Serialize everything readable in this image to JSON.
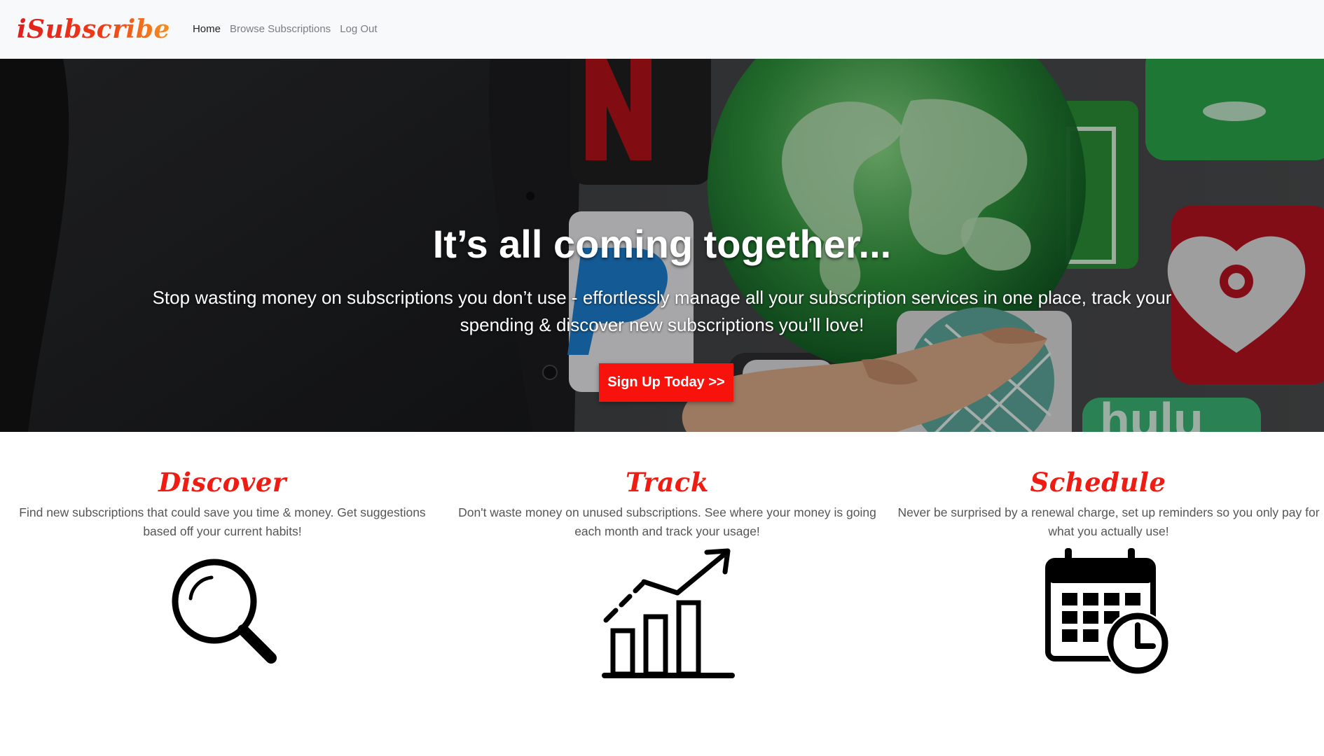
{
  "navbar": {
    "brand": "iSubscribe",
    "links": [
      {
        "label": "Home",
        "active": true
      },
      {
        "label": "Browse Subscriptions",
        "active": false
      },
      {
        "label": "Log Out",
        "active": false
      }
    ]
  },
  "hero": {
    "title": "It’s all coming together...",
    "subtitle": "Stop wasting money on subscriptions you don’t use - effortlessly manage all your subscription services in one place, track your spending & discover new subscriptions you’ll love!",
    "cta_label": "Sign Up Today >>",
    "background_icons": [
      "netflix-tile",
      "globe",
      "paypal-tile",
      "iheartradio-tile",
      "hulu-tile",
      "green-app-tile"
    ]
  },
  "features": [
    {
      "title": "Discover",
      "description": "Find new subscriptions that could save you time & money. Get suggestions based off your current habits!",
      "icon": "magnifying-glass-icon"
    },
    {
      "title": "Track",
      "description": "Don't waste money on unused subscriptions. See where your money is going each month and track your usage!",
      "icon": "growth-chart-icon"
    },
    {
      "title": "Schedule",
      "description": "Never be surprised by a renewal charge, set up reminders so you only pay for what you actually use!",
      "icon": "calendar-clock-icon"
    }
  ],
  "colors": {
    "accent": "#f7130c",
    "feature_title": "#ee1c13",
    "navbar_bg": "#f8f9fa"
  }
}
